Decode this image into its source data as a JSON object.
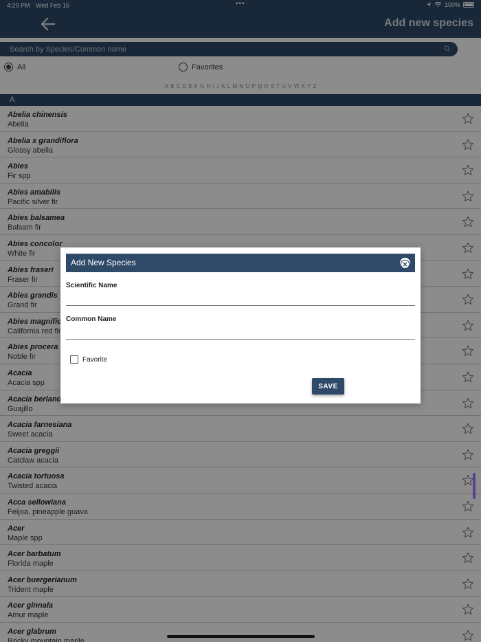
{
  "status_bar": {
    "time": "4:29 PM",
    "date": "Wed Feb 16",
    "dots": "•••",
    "battery": "100%"
  },
  "nav": {
    "title": "Add new species"
  },
  "search": {
    "placeholder": "Search by Species/Common name"
  },
  "filter": {
    "all_label": "All",
    "favorites_label": "Favorites",
    "selected": "All"
  },
  "alphabet": [
    "A",
    "B",
    "C",
    "D",
    "E",
    "F",
    "G",
    "H",
    "I",
    "J",
    "K",
    "L",
    "M",
    "N",
    "O",
    "P",
    "Q",
    "R",
    "S",
    "T",
    "U",
    "V",
    "W",
    "X",
    "Y",
    "Z"
  ],
  "section": {
    "letter": "A"
  },
  "species": [
    {
      "scientific": "Abelia chinensis",
      "common": "Abelia"
    },
    {
      "scientific": "Abelia x grandiflora",
      "common": "Glossy abelia"
    },
    {
      "scientific": "Abies",
      "common": "Fir spp"
    },
    {
      "scientific": "Abies amabilis",
      "common": "Pacific silver fir"
    },
    {
      "scientific": "Abies balsamea",
      "common": "Balsam fir"
    },
    {
      "scientific": "Abies concolor",
      "common": "White fir"
    },
    {
      "scientific": "Abies fraseri",
      "common": "Fraser fir"
    },
    {
      "scientific": "Abies grandis",
      "common": "Grand fir"
    },
    {
      "scientific": "Abies magnific",
      "common": "California red fir"
    },
    {
      "scientific": "Abies procera",
      "common": "Noble fir"
    },
    {
      "scientific": "Acacia",
      "common": "Acacia spp"
    },
    {
      "scientific": "Acacia berland",
      "common": "Guajillo"
    },
    {
      "scientific": "Acacia farnesiana",
      "common": "Sweet acacia"
    },
    {
      "scientific": "Acacia greggii",
      "common": "Catclaw acacia"
    },
    {
      "scientific": "Acacia tortuosa",
      "common": "Twisted acacia"
    },
    {
      "scientific": "Acca sellowiana",
      "common": "Feijoa, pineapple guava"
    },
    {
      "scientific": "Acer",
      "common": "Maple spp"
    },
    {
      "scientific": "Acer barbatum",
      "common": "Florida maple"
    },
    {
      "scientific": "Acer buergerianum",
      "common": "Trident maple"
    },
    {
      "scientific": "Acer ginnala",
      "common": "Amur maple"
    },
    {
      "scientific": "Acer glabrum",
      "common": "Rocky mountain maple"
    }
  ],
  "modal": {
    "title": "Add New Species",
    "scientific_label": "Scientific Name",
    "scientific_value": "",
    "common_label": "Common Name",
    "common_value": "",
    "favorite_label": "Favorite",
    "favorite_checked": false,
    "save_label": "SAVE"
  },
  "colors": {
    "primary": "#2f4a68",
    "scroll_indicator": "#5a3e98"
  }
}
